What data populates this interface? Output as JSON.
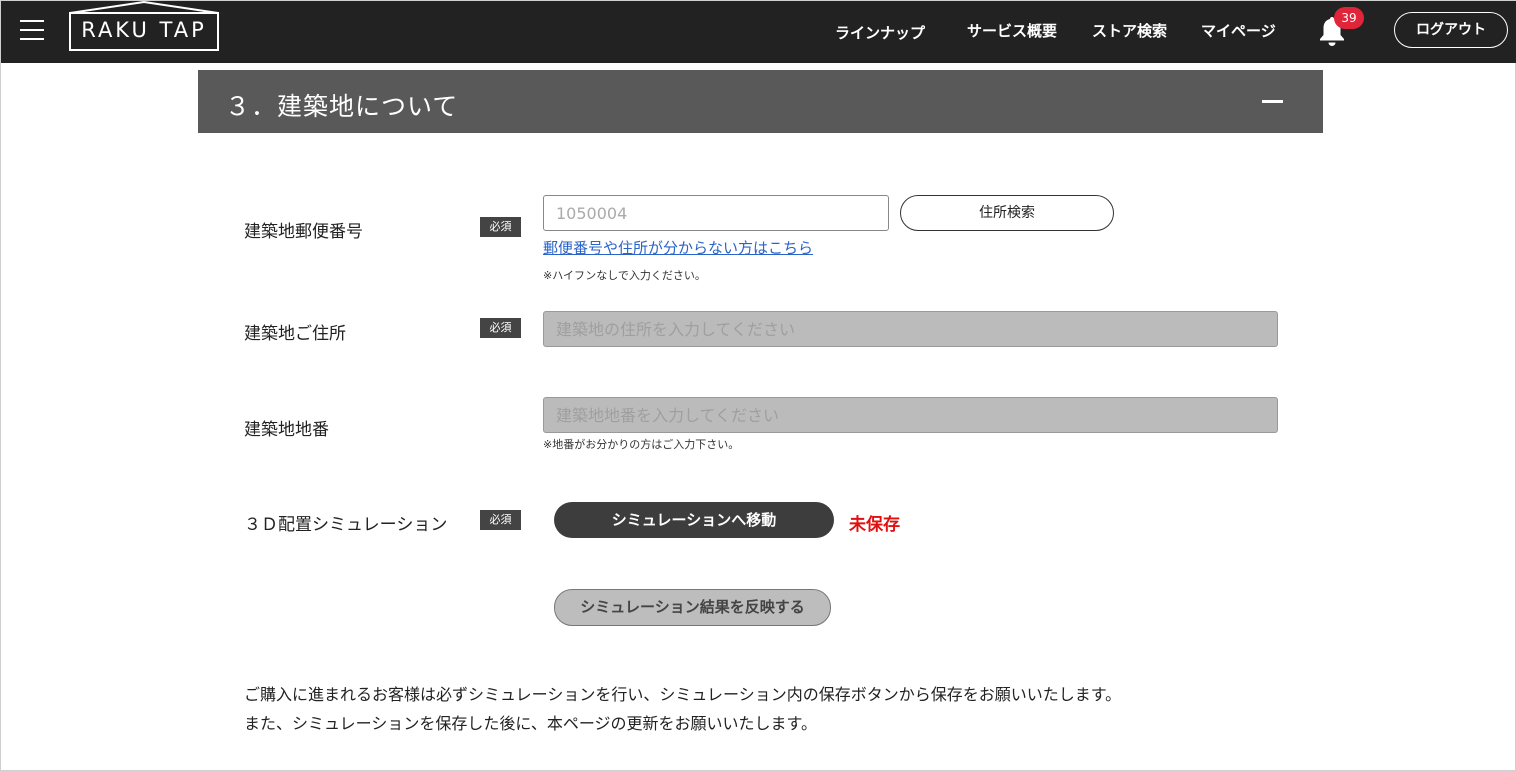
{
  "header": {
    "logo_text": "RAKU TAP",
    "nav": [
      "ラインナップ",
      "サービス概要",
      "ストア検索",
      "マイページ"
    ],
    "notification_count": "39",
    "logout_label": "ログアウト"
  },
  "section": {
    "title": "３．建築地について"
  },
  "form": {
    "required_badge": "必須",
    "postal": {
      "label": "建築地郵便番号",
      "placeholder": "1050004",
      "search_button": "住所検索",
      "help_link": "郵便番号や住所が分からない方はこちら",
      "note": "※ハイフンなしで入力ください。"
    },
    "address": {
      "label": "建築地ご住所",
      "placeholder": "建築地の住所を入力してください"
    },
    "lot": {
      "label": "建築地地番",
      "placeholder": "建築地地番を入力してください",
      "note": "※地番がお分かりの方はご入力下さい。"
    },
    "simulation": {
      "label": "３Ｄ配置シミュレーション",
      "move_button": "シミュレーションへ移動",
      "status": "未保存",
      "apply_button": "シミュレーション結果を反映する"
    }
  },
  "message": {
    "line1": "ご購入に進まれるお客様は必ずシミュレーションを行い、シミュレーション内の保存ボタンから保存をお願いいたします。",
    "line2": "また、シミュレーションを保存した後に、本ページの更新をお願いいたします。"
  },
  "colors": {
    "header_bg": "#222222",
    "section_bg": "#595959",
    "badge_red": "#e0243a",
    "unsaved_red": "#e01010",
    "link_blue": "#2a63c9"
  }
}
